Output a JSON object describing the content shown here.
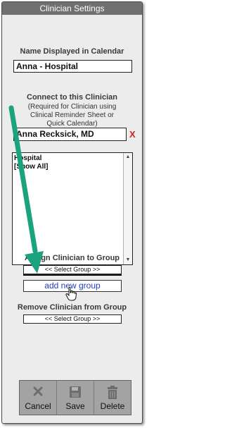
{
  "window": {
    "title": "Clinician Settings"
  },
  "calendar_name": {
    "label": "Name Displayed in Calendar",
    "value": "Anna - Hospital"
  },
  "connect": {
    "label": "Connect to this Clinician",
    "note_line1": "(Required for Clinician using",
    "note_line2": "Clinical Reminder Sheet or",
    "note_line3": "Quick Calendar)",
    "value": "Anna Recksick, MD",
    "clear": "X"
  },
  "groups_list": {
    "items": [
      "Hospital",
      "[Show All]"
    ]
  },
  "assign": {
    "label": "Assign Clinician to Group",
    "select_value": "<< Select Group >>",
    "add_link": "add new group"
  },
  "remove": {
    "label": "Remove Clinician from Group",
    "select_value": "<< Select Group >>"
  },
  "toolbar": {
    "cancel_label": "Cancel",
    "save_label": "Save",
    "delete_label": "Delete"
  },
  "colors": {
    "titlebar": "#707070",
    "panel": "#ececec",
    "toolbar": "#a3a3a3",
    "annotation_arrow": "#1aa37e",
    "clear_x": "#d42020",
    "link": "#1f3fbf"
  },
  "annotation": {
    "icon": "pointing-arrow"
  }
}
